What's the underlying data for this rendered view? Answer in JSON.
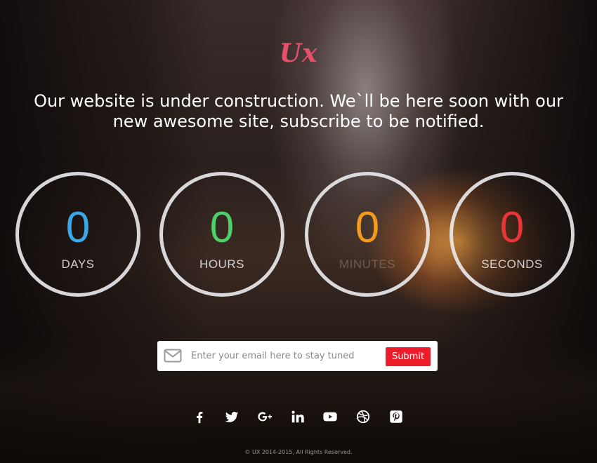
{
  "logo": {
    "text": "Ux",
    "color": "#e8506a"
  },
  "headline": "Our website is under construction. We`ll be here soon with our new awesome site, subscribe to be notified.",
  "countdown": [
    {
      "value": "0",
      "unit": "DAYS",
      "color": "#3ba7e8"
    },
    {
      "value": "0",
      "unit": "HOURS",
      "color": "#4cd06a"
    },
    {
      "value": "0",
      "unit": "MINUTES",
      "color": "#f39a1c"
    },
    {
      "value": "0",
      "unit": "SECONDS",
      "color": "#e8353a"
    }
  ],
  "subscribe": {
    "icon": "envelope-icon",
    "placeholder": "Enter your email here to stay tuned",
    "submit_label": "Submit",
    "submit_color": "#ec1c2a"
  },
  "socials": [
    {
      "icon": "facebook-icon"
    },
    {
      "icon": "twitter-icon"
    },
    {
      "icon": "google-plus-icon"
    },
    {
      "icon": "linkedin-icon"
    },
    {
      "icon": "youtube-icon"
    },
    {
      "icon": "dribbble-icon"
    },
    {
      "icon": "pinterest-icon"
    }
  ],
  "footer": "© UX 2014-2015, All Rights Reserved."
}
